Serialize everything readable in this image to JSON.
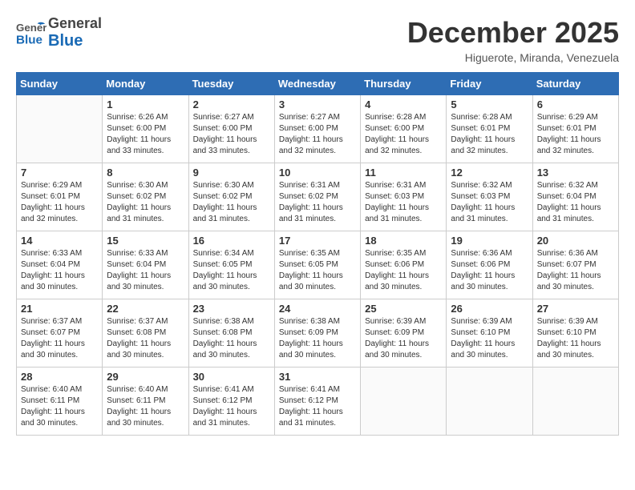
{
  "header": {
    "logo_general": "General",
    "logo_blue": "Blue",
    "month_title": "December 2025",
    "location": "Higuerote, Miranda, Venezuela"
  },
  "calendar": {
    "days_of_week": [
      "Sunday",
      "Monday",
      "Tuesday",
      "Wednesday",
      "Thursday",
      "Friday",
      "Saturday"
    ],
    "weeks": [
      [
        {
          "day": "",
          "info": ""
        },
        {
          "day": "1",
          "info": "Sunrise: 6:26 AM\nSunset: 6:00 PM\nDaylight: 11 hours\nand 33 minutes."
        },
        {
          "day": "2",
          "info": "Sunrise: 6:27 AM\nSunset: 6:00 PM\nDaylight: 11 hours\nand 33 minutes."
        },
        {
          "day": "3",
          "info": "Sunrise: 6:27 AM\nSunset: 6:00 PM\nDaylight: 11 hours\nand 32 minutes."
        },
        {
          "day": "4",
          "info": "Sunrise: 6:28 AM\nSunset: 6:00 PM\nDaylight: 11 hours\nand 32 minutes."
        },
        {
          "day": "5",
          "info": "Sunrise: 6:28 AM\nSunset: 6:01 PM\nDaylight: 11 hours\nand 32 minutes."
        },
        {
          "day": "6",
          "info": "Sunrise: 6:29 AM\nSunset: 6:01 PM\nDaylight: 11 hours\nand 32 minutes."
        }
      ],
      [
        {
          "day": "7",
          "info": "Sunrise: 6:29 AM\nSunset: 6:01 PM\nDaylight: 11 hours\nand 32 minutes."
        },
        {
          "day": "8",
          "info": "Sunrise: 6:30 AM\nSunset: 6:02 PM\nDaylight: 11 hours\nand 31 minutes."
        },
        {
          "day": "9",
          "info": "Sunrise: 6:30 AM\nSunset: 6:02 PM\nDaylight: 11 hours\nand 31 minutes."
        },
        {
          "day": "10",
          "info": "Sunrise: 6:31 AM\nSunset: 6:02 PM\nDaylight: 11 hours\nand 31 minutes."
        },
        {
          "day": "11",
          "info": "Sunrise: 6:31 AM\nSunset: 6:03 PM\nDaylight: 11 hours\nand 31 minutes."
        },
        {
          "day": "12",
          "info": "Sunrise: 6:32 AM\nSunset: 6:03 PM\nDaylight: 11 hours\nand 31 minutes."
        },
        {
          "day": "13",
          "info": "Sunrise: 6:32 AM\nSunset: 6:04 PM\nDaylight: 11 hours\nand 31 minutes."
        }
      ],
      [
        {
          "day": "14",
          "info": "Sunrise: 6:33 AM\nSunset: 6:04 PM\nDaylight: 11 hours\nand 30 minutes."
        },
        {
          "day": "15",
          "info": "Sunrise: 6:33 AM\nSunset: 6:04 PM\nDaylight: 11 hours\nand 30 minutes."
        },
        {
          "day": "16",
          "info": "Sunrise: 6:34 AM\nSunset: 6:05 PM\nDaylight: 11 hours\nand 30 minutes."
        },
        {
          "day": "17",
          "info": "Sunrise: 6:35 AM\nSunset: 6:05 PM\nDaylight: 11 hours\nand 30 minutes."
        },
        {
          "day": "18",
          "info": "Sunrise: 6:35 AM\nSunset: 6:06 PM\nDaylight: 11 hours\nand 30 minutes."
        },
        {
          "day": "19",
          "info": "Sunrise: 6:36 AM\nSunset: 6:06 PM\nDaylight: 11 hours\nand 30 minutes."
        },
        {
          "day": "20",
          "info": "Sunrise: 6:36 AM\nSunset: 6:07 PM\nDaylight: 11 hours\nand 30 minutes."
        }
      ],
      [
        {
          "day": "21",
          "info": "Sunrise: 6:37 AM\nSunset: 6:07 PM\nDaylight: 11 hours\nand 30 minutes."
        },
        {
          "day": "22",
          "info": "Sunrise: 6:37 AM\nSunset: 6:08 PM\nDaylight: 11 hours\nand 30 minutes."
        },
        {
          "day": "23",
          "info": "Sunrise: 6:38 AM\nSunset: 6:08 PM\nDaylight: 11 hours\nand 30 minutes."
        },
        {
          "day": "24",
          "info": "Sunrise: 6:38 AM\nSunset: 6:09 PM\nDaylight: 11 hours\nand 30 minutes."
        },
        {
          "day": "25",
          "info": "Sunrise: 6:39 AM\nSunset: 6:09 PM\nDaylight: 11 hours\nand 30 minutes."
        },
        {
          "day": "26",
          "info": "Sunrise: 6:39 AM\nSunset: 6:10 PM\nDaylight: 11 hours\nand 30 minutes."
        },
        {
          "day": "27",
          "info": "Sunrise: 6:39 AM\nSunset: 6:10 PM\nDaylight: 11 hours\nand 30 minutes."
        }
      ],
      [
        {
          "day": "28",
          "info": "Sunrise: 6:40 AM\nSunset: 6:11 PM\nDaylight: 11 hours\nand 30 minutes."
        },
        {
          "day": "29",
          "info": "Sunrise: 6:40 AM\nSunset: 6:11 PM\nDaylight: 11 hours\nand 30 minutes."
        },
        {
          "day": "30",
          "info": "Sunrise: 6:41 AM\nSunset: 6:12 PM\nDaylight: 11 hours\nand 31 minutes."
        },
        {
          "day": "31",
          "info": "Sunrise: 6:41 AM\nSunset: 6:12 PM\nDaylight: 11 hours\nand 31 minutes."
        },
        {
          "day": "",
          "info": ""
        },
        {
          "day": "",
          "info": ""
        },
        {
          "day": "",
          "info": ""
        }
      ]
    ]
  }
}
